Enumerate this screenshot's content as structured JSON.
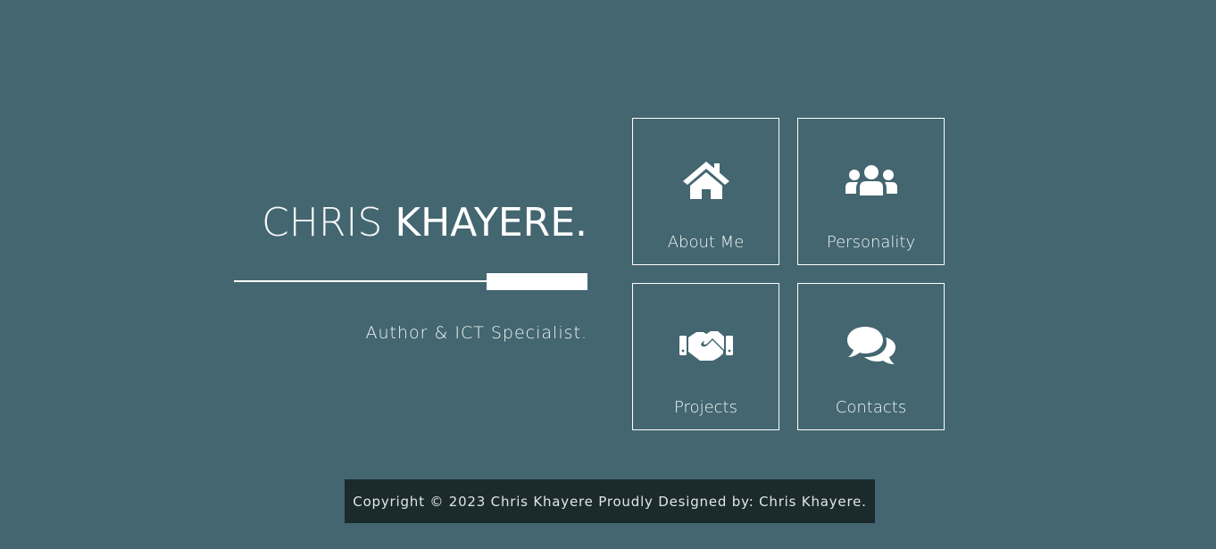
{
  "hero": {
    "first_name": "CHRIS",
    "last_name": "KHAYERE.",
    "tagline": "Author & ICT Specialist."
  },
  "tiles": [
    {
      "label": "About Me",
      "icon": "home-icon"
    },
    {
      "label": "Personality",
      "icon": "users-icon"
    },
    {
      "label": "Projects",
      "icon": "handshake-icon"
    },
    {
      "label": "Contacts",
      "icon": "comments-icon"
    }
  ],
  "footer": {
    "text": "Copyright © 2023 Chris Khayere Proudly Designed by: Chris Khayere."
  },
  "colors": {
    "background": "#436670",
    "footer_background": "#1b2a2d",
    "foreground": "#ffffff"
  }
}
